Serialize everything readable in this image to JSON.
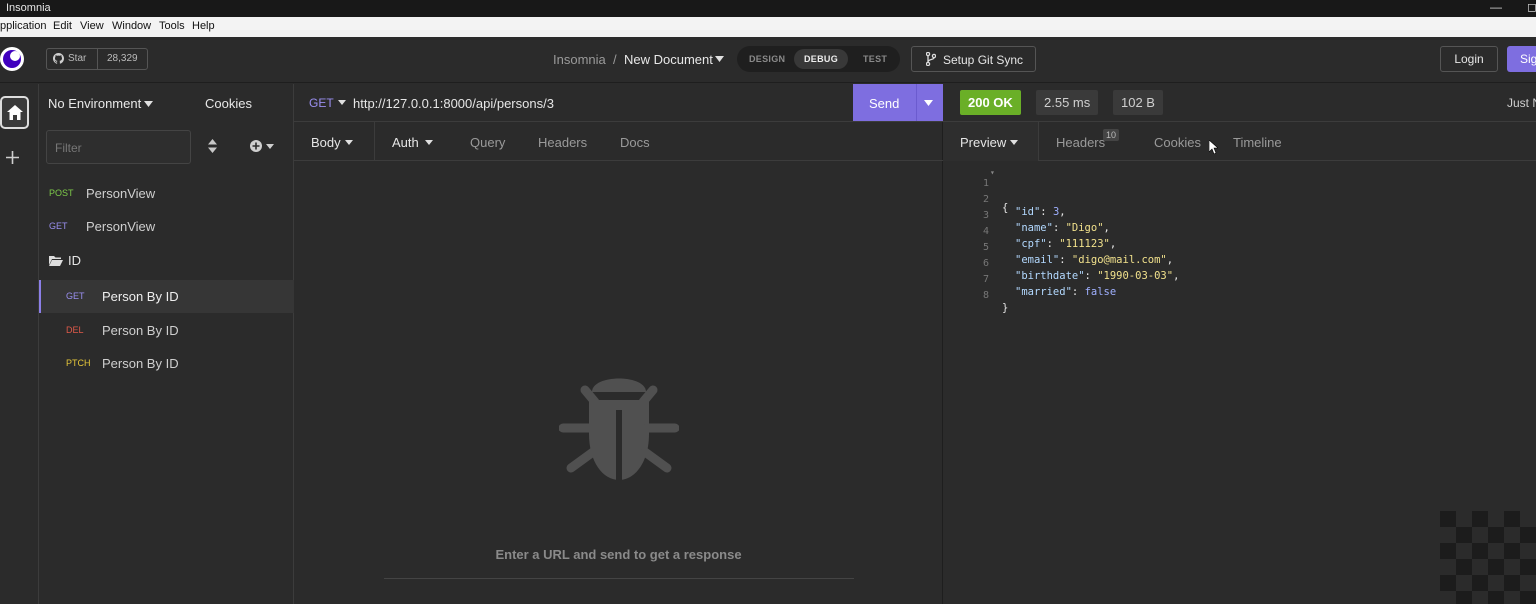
{
  "titlebar": {
    "title": "Insomnia",
    "minimize": "—",
    "maximize": "◻"
  },
  "menu": {
    "items": [
      "pplication",
      "Edit",
      "View",
      "Window",
      "Tools",
      "Help"
    ]
  },
  "github": {
    "star_label": "Star",
    "count": "28,329"
  },
  "breadcrumb": {
    "root": "Insomnia",
    "sep": "/",
    "document": "New Document"
  },
  "modes": {
    "design": "DESIGN",
    "debug": "DEBUG",
    "test": "TEST"
  },
  "git": {
    "label": "Setup Git Sync"
  },
  "auth": {
    "login": "Login",
    "signup": "Sig"
  },
  "sidebar": {
    "environment": "No Environment",
    "cookies": "Cookies",
    "filter_placeholder": "Filter",
    "requests": [
      {
        "method": "POST",
        "name": "PersonView",
        "color": "#7ecb4a"
      },
      {
        "method": "GET",
        "name": "PersonView",
        "color": "#9a8ff0"
      }
    ],
    "folder": {
      "name": "ID"
    },
    "folder_requests": [
      {
        "method": "GET",
        "name": "Person By ID",
        "color": "#9a8ff0"
      },
      {
        "method": "DEL",
        "name": "Person By ID",
        "color": "#e05a4a"
      },
      {
        "method": "PTCH",
        "name": "Person By ID",
        "color": "#e6c73a"
      }
    ]
  },
  "request": {
    "method": "GET",
    "url": "http://127.0.0.1:8000/api/persons/3",
    "send": "Send",
    "tabs": {
      "body": "Body",
      "auth": "Auth",
      "query": "Query",
      "headers": "Headers",
      "docs": "Docs"
    },
    "empty_message": "Enter a URL and send to get a response"
  },
  "response": {
    "status": "200 OK",
    "status_color": "#6aaf27",
    "time": "2.55 ms",
    "size": "102 B",
    "time_ago": "Just N",
    "tabs": {
      "preview": "Preview",
      "headers": "Headers",
      "headers_count": "10",
      "cookies": "Cookies",
      "timeline": "Timeline"
    },
    "lines": [
      {
        "n": "1",
        "fold": "▾",
        "text": "{"
      },
      {
        "n": "2",
        "key": "\"id\"",
        "value": "3",
        "kind": "num",
        "comma": ","
      },
      {
        "n": "3",
        "key": "\"name\"",
        "value": "\"Digo\"",
        "kind": "str",
        "comma": ","
      },
      {
        "n": "4",
        "key": "\"cpf\"",
        "value": "\"111123\"",
        "kind": "str",
        "comma": ","
      },
      {
        "n": "5",
        "key": "\"email\"",
        "value": "\"digo@mail.com\"",
        "kind": "str",
        "comma": ","
      },
      {
        "n": "6",
        "key": "\"birthdate\"",
        "value": "\"1990-03-03\"",
        "kind": "str",
        "comma": ","
      },
      {
        "n": "7",
        "key": "\"married\"",
        "value": "false",
        "kind": "bool",
        "comma": ""
      },
      {
        "n": "8",
        "text": "}"
      }
    ]
  },
  "colors": {
    "accent": "#7e6ee0",
    "background": "#2b2b2b"
  }
}
